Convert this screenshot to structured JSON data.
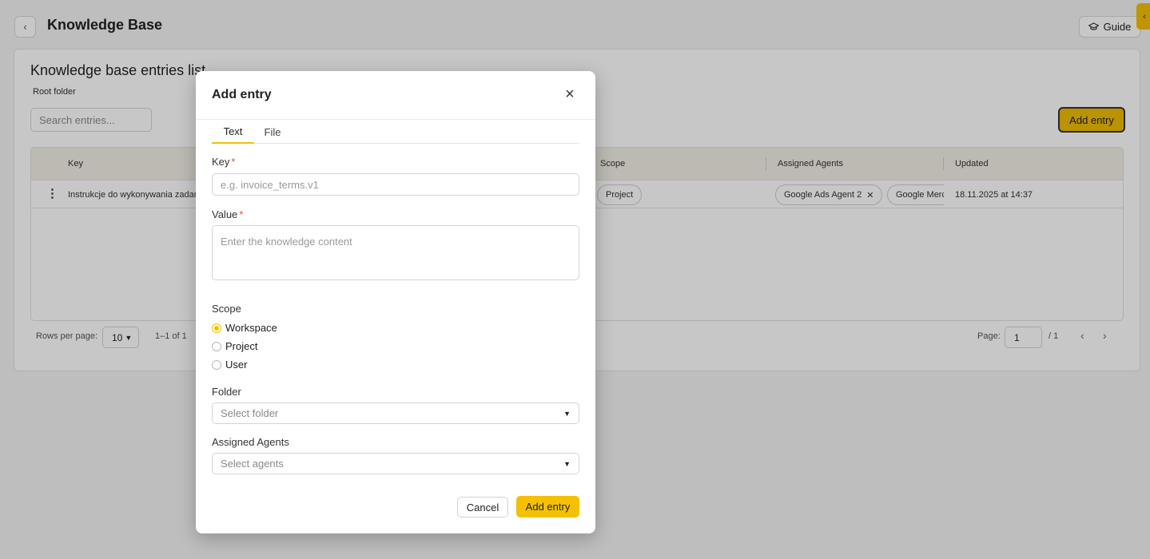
{
  "header": {
    "back_icon": "chevron-left-icon",
    "title": "Knowledge Base",
    "guide_label": "Guide",
    "guide_icon": "graduation-cap-icon"
  },
  "list": {
    "title": "Knowledge base entries list",
    "folder": "Root folder",
    "search_placeholder": "Search entries...",
    "add_button": "Add entry",
    "columns": [
      "Key",
      "Scope",
      "Assigned Agents",
      "Updated"
    ],
    "rows": [
      {
        "key": "Instrukcje do wykonywania zadań",
        "scope": "Project",
        "agents": [
          "Google Ads Agent 2",
          "Google Merchant"
        ],
        "updated": "18.11.2025 at 14:37"
      }
    ],
    "pagination": {
      "rows_per_page_label": "Rows per page:",
      "rows_per_page": "10",
      "range": "1–1 of 1",
      "page_label": "Page:",
      "page": "1",
      "total": "/ 1"
    }
  },
  "modal": {
    "title": "Add entry",
    "tabs": [
      {
        "label": "Text",
        "active": true
      },
      {
        "label": "File",
        "active": false
      }
    ],
    "key_label": "Key",
    "key_placeholder": "e.g. invoice_terms.v1",
    "value_label": "Value",
    "value_placeholder": "Enter the knowledge content",
    "required_mark": "*",
    "scope_label": "Scope",
    "scope_options": [
      {
        "label": "Workspace",
        "checked": true
      },
      {
        "label": "Project",
        "checked": false
      },
      {
        "label": "User",
        "checked": false
      }
    ],
    "folder_label": "Folder",
    "folder_placeholder": "Select folder",
    "agents_label": "Assigned Agents",
    "agents_placeholder": "Select agents",
    "cancel_label": "Cancel",
    "submit_label": "Add entry"
  },
  "colors": {
    "accent": "#f5c000",
    "required": "#e0533b"
  }
}
